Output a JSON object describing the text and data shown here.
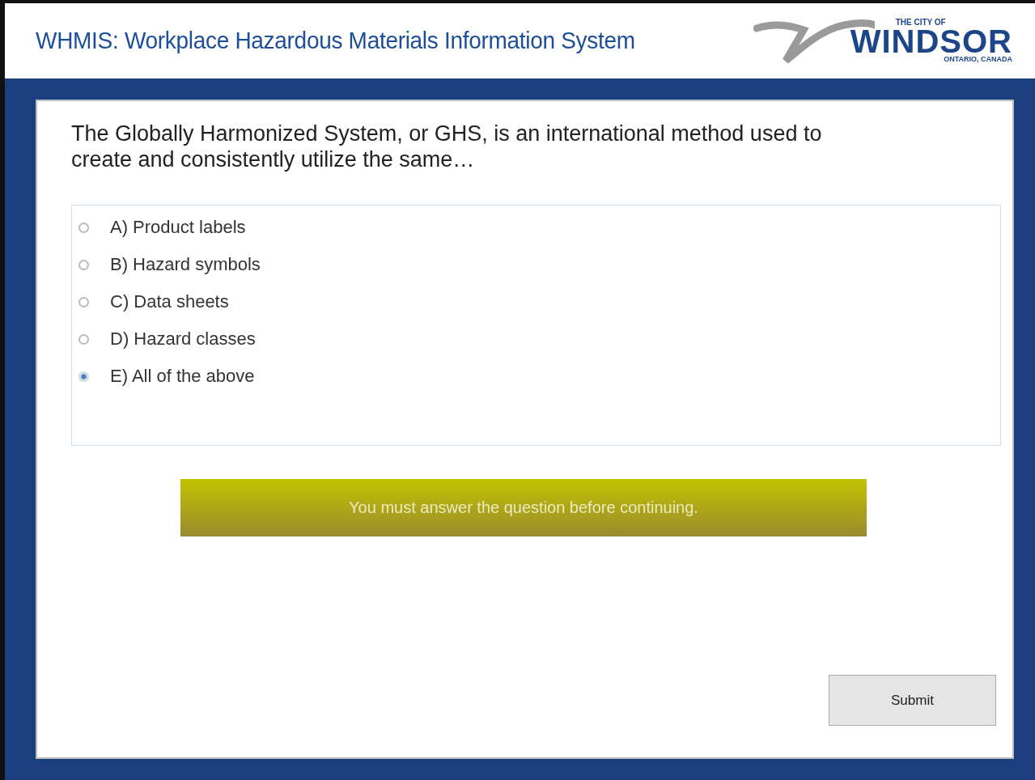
{
  "header": {
    "title": "WHMIS: Workplace Hazardous Materials Information System",
    "logo": {
      "top": "THE CITY OF",
      "name": "WINDSOR",
      "bottom": "ONTARIO, CANADA"
    }
  },
  "question": "The Globally Harmonized System, or GHS, is an international method used to create and consistently utilize the same…",
  "options": [
    {
      "label": "A) Product labels",
      "selected": false
    },
    {
      "label": "B) Hazard symbols",
      "selected": false
    },
    {
      "label": "C) Data sheets",
      "selected": false
    },
    {
      "label": "D) Hazard classes",
      "selected": false
    },
    {
      "label": "E) All of the above",
      "selected": true
    }
  ],
  "message": "You must answer the question before continuing.",
  "submit": "Submit"
}
